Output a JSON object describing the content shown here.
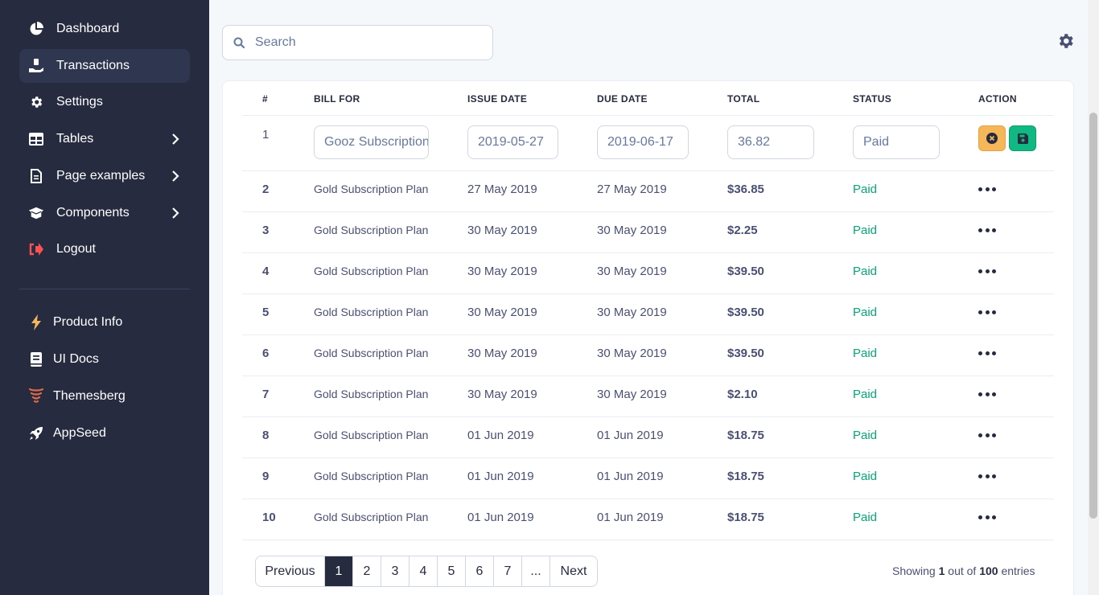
{
  "sidebar": {
    "items": [
      {
        "label": "Dashboard",
        "icon": "pie-chart-icon"
      },
      {
        "label": "Transactions",
        "icon": "hand-coins-icon",
        "active": true
      },
      {
        "label": "Settings",
        "icon": "gear-icon"
      },
      {
        "label": "Tables",
        "icon": "table-icon",
        "has_submenu": true
      },
      {
        "label": "Page examples",
        "icon": "document-icon",
        "has_submenu": true
      },
      {
        "label": "Components",
        "icon": "box-icon",
        "has_submenu": true
      },
      {
        "label": "Logout",
        "icon": "logout-icon"
      }
    ],
    "secondary": [
      {
        "label": "Product Info",
        "icon": "lightning-icon"
      },
      {
        "label": "UI Docs",
        "icon": "book-icon"
      },
      {
        "label": "Themesberg",
        "icon": "themesberg-logo-icon"
      },
      {
        "label": "AppSeed",
        "icon": "rocket-icon"
      }
    ]
  },
  "search": {
    "placeholder": "Search"
  },
  "table": {
    "headers": [
      "#",
      "BILL FOR",
      "ISSUE DATE",
      "DUE DATE",
      "TOTAL",
      "STATUS",
      "ACTION"
    ],
    "edit_row": {
      "num": "1",
      "bill_for": "Gooz Subscription Plan",
      "issue_date": "2019-05-27",
      "due_date": "2019-06-17",
      "total": "36.82",
      "status": "Paid"
    },
    "rows": [
      {
        "num": "2",
        "bill_for": "Gold Subscription Plan",
        "issue_date": "27 May 2019",
        "due_date": "27 May 2019",
        "total": "$36.85",
        "status": "Paid"
      },
      {
        "num": "3",
        "bill_for": "Gold Subscription Plan",
        "issue_date": "30 May 2019",
        "due_date": "30 May 2019",
        "total": "$2.25",
        "status": "Paid"
      },
      {
        "num": "4",
        "bill_for": "Gold Subscription Plan",
        "issue_date": "30 May 2019",
        "due_date": "30 May 2019",
        "total": "$39.50",
        "status": "Paid"
      },
      {
        "num": "5",
        "bill_for": "Gold Subscription Plan",
        "issue_date": "30 May 2019",
        "due_date": "30 May 2019",
        "total": "$39.50",
        "status": "Paid"
      },
      {
        "num": "6",
        "bill_for": "Gold Subscription Plan",
        "issue_date": "30 May 2019",
        "due_date": "30 May 2019",
        "total": "$39.50",
        "status": "Paid"
      },
      {
        "num": "7",
        "bill_for": "Gold Subscription Plan",
        "issue_date": "30 May 2019",
        "due_date": "30 May 2019",
        "total": "$2.10",
        "status": "Paid"
      },
      {
        "num": "8",
        "bill_for": "Gold Subscription Plan",
        "issue_date": "01 Jun 2019",
        "due_date": "01 Jun 2019",
        "total": "$18.75",
        "status": "Paid"
      },
      {
        "num": "9",
        "bill_for": "Gold Subscription Plan",
        "issue_date": "01 Jun 2019",
        "due_date": "01 Jun 2019",
        "total": "$18.75",
        "status": "Paid"
      },
      {
        "num": "10",
        "bill_for": "Gold Subscription Plan",
        "issue_date": "01 Jun 2019",
        "due_date": "01 Jun 2019",
        "total": "$18.75",
        "status": "Paid"
      }
    ]
  },
  "pagination": {
    "previous": "Previous",
    "pages": [
      "1",
      "2",
      "3",
      "4",
      "5",
      "6",
      "7",
      "..."
    ],
    "next": "Next",
    "current": "1"
  },
  "footer": {
    "showing_prefix": "Showing",
    "showing_current": "1",
    "showing_mid": "out of",
    "showing_total": "100",
    "showing_suffix": "entries"
  },
  "colors": {
    "sidebar_bg": "#262b40",
    "active_bg": "#2e3650",
    "status_paid": "#05a677",
    "cancel_button": "#f5b759",
    "save_button": "#10b981",
    "logout_icon": "#fa5252",
    "lightning_icon": "#f5b759"
  }
}
